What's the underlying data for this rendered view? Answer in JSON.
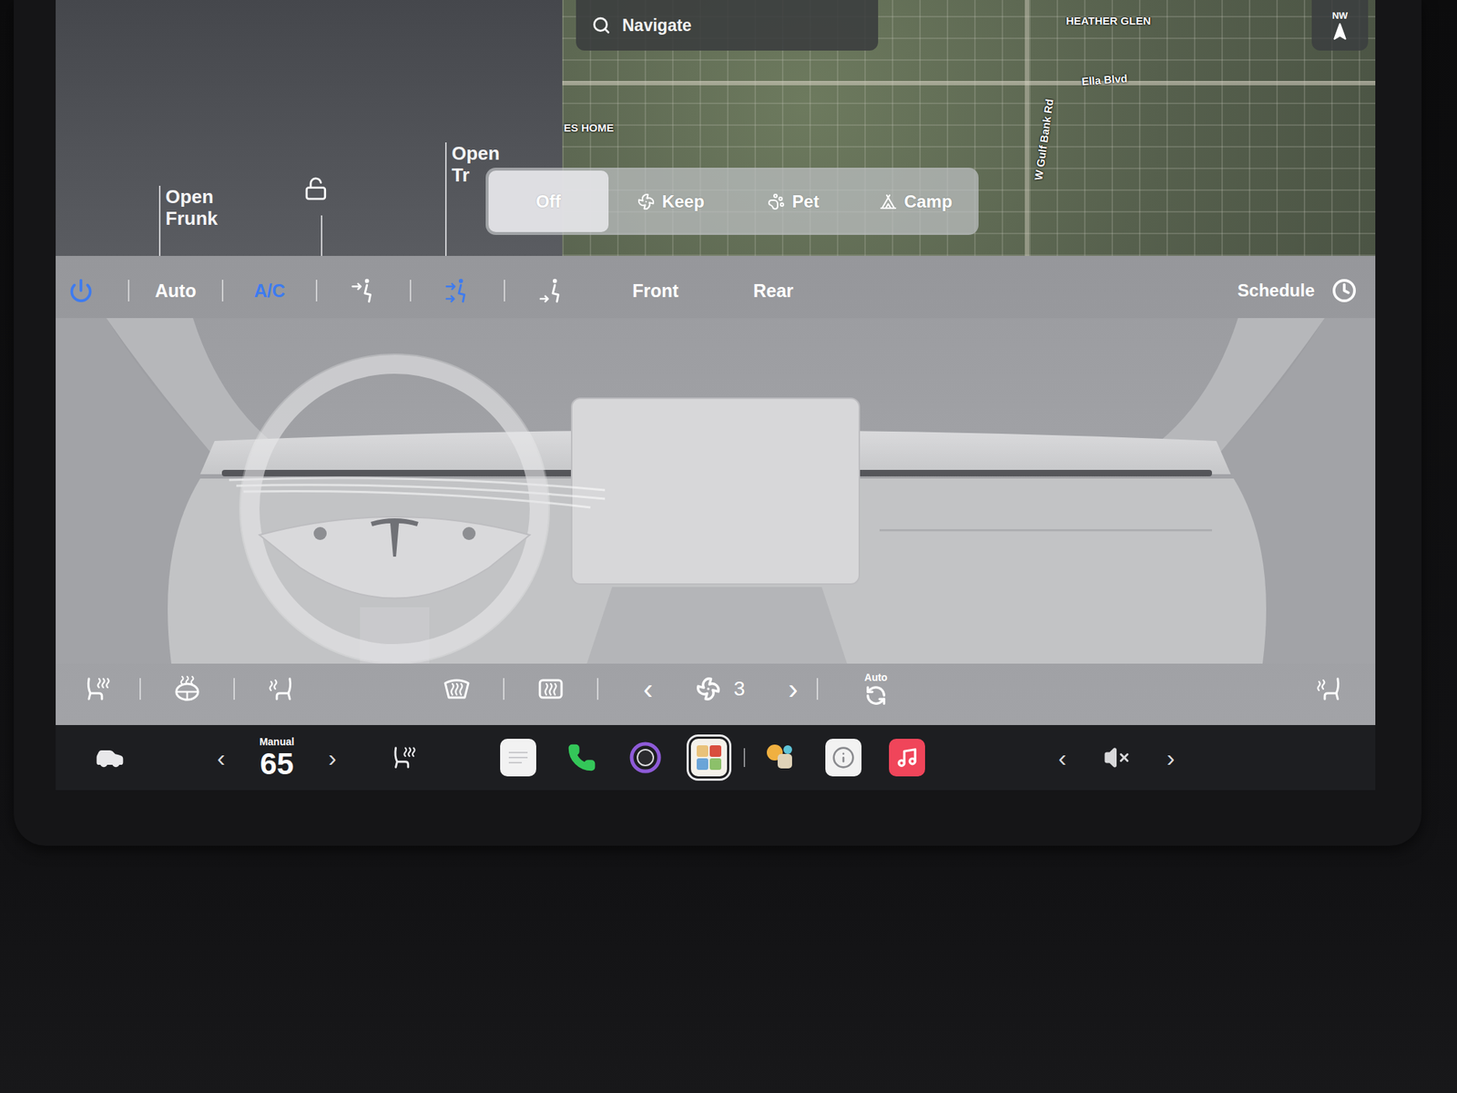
{
  "car": {
    "callouts": [
      {
        "label": "Open Frunk"
      },
      {
        "label": "Open Tr"
      }
    ],
    "lock": {
      "locked": false
    }
  },
  "map": {
    "search": {
      "placeholder": "Navigate"
    },
    "labels": [
      {
        "text": "HEATHER GLEN"
      },
      {
        "text": "Ella Blvd"
      },
      {
        "text": "ES HOME"
      },
      {
        "text": "W Gulf Bank Rd"
      }
    ],
    "compass": "NW"
  },
  "keep_modes": [
    {
      "label": "Off",
      "kind": "off",
      "selected": true
    },
    {
      "label": "Keep",
      "kind": "keep",
      "selected": false
    },
    {
      "label": "Pet",
      "kind": "pet",
      "selected": false
    },
    {
      "label": "Camp",
      "kind": "camp",
      "selected": false
    }
  ],
  "climate": {
    "power": {
      "on": true
    },
    "toggles": [
      {
        "label": "Auto",
        "on": false
      },
      {
        "label": "A/C",
        "on": true
      }
    ],
    "airflow": [
      {
        "kind": "face",
        "selected": false
      },
      {
        "kind": "face-feet",
        "selected": true
      },
      {
        "kind": "feet",
        "selected": false
      }
    ],
    "zones": [
      {
        "label": "Front",
        "selected": false
      },
      {
        "label": "Rear",
        "selected": false
      }
    ],
    "schedule": "Schedule",
    "seat_controls": [
      {
        "kind": "seat-heat"
      },
      {
        "kind": "wheel-heat"
      },
      {
        "kind": "seat-vent"
      }
    ],
    "defrost": [
      {
        "kind": "front",
        "on": false
      },
      {
        "kind": "rear",
        "on": false
      }
    ],
    "fan": {
      "speed": "3",
      "prev": "‹",
      "next": "›"
    },
    "recirculate": {
      "label": "Auto"
    }
  },
  "taskbar": {
    "temperature": {
      "mode": "Manual",
      "value": "65",
      "prev": "‹",
      "next": "›"
    },
    "apps": [
      {
        "kind": "notes",
        "color": "#f2f2f2",
        "selected": false,
        "divider_after": false
      },
      {
        "kind": "phone",
        "color": "#34c759",
        "selected": false,
        "divider_after": false
      },
      {
        "kind": "camera",
        "color": "#8e5bd8",
        "selected": false,
        "divider_after": false
      },
      {
        "kind": "toybox",
        "color": "#e9c27a",
        "selected": true,
        "divider_after": true
      },
      {
        "kind": "arcade",
        "color": "#f0b040",
        "selected": false,
        "divider_after": false
      },
      {
        "kind": "manual",
        "color": "#f2f2f2",
        "selected": false,
        "divider_after": false
      },
      {
        "kind": "music",
        "color": "#f0455a",
        "selected": false,
        "divider_after": false
      }
    ],
    "volume": {
      "muted": true,
      "prev": "‹",
      "next": "›"
    }
  }
}
